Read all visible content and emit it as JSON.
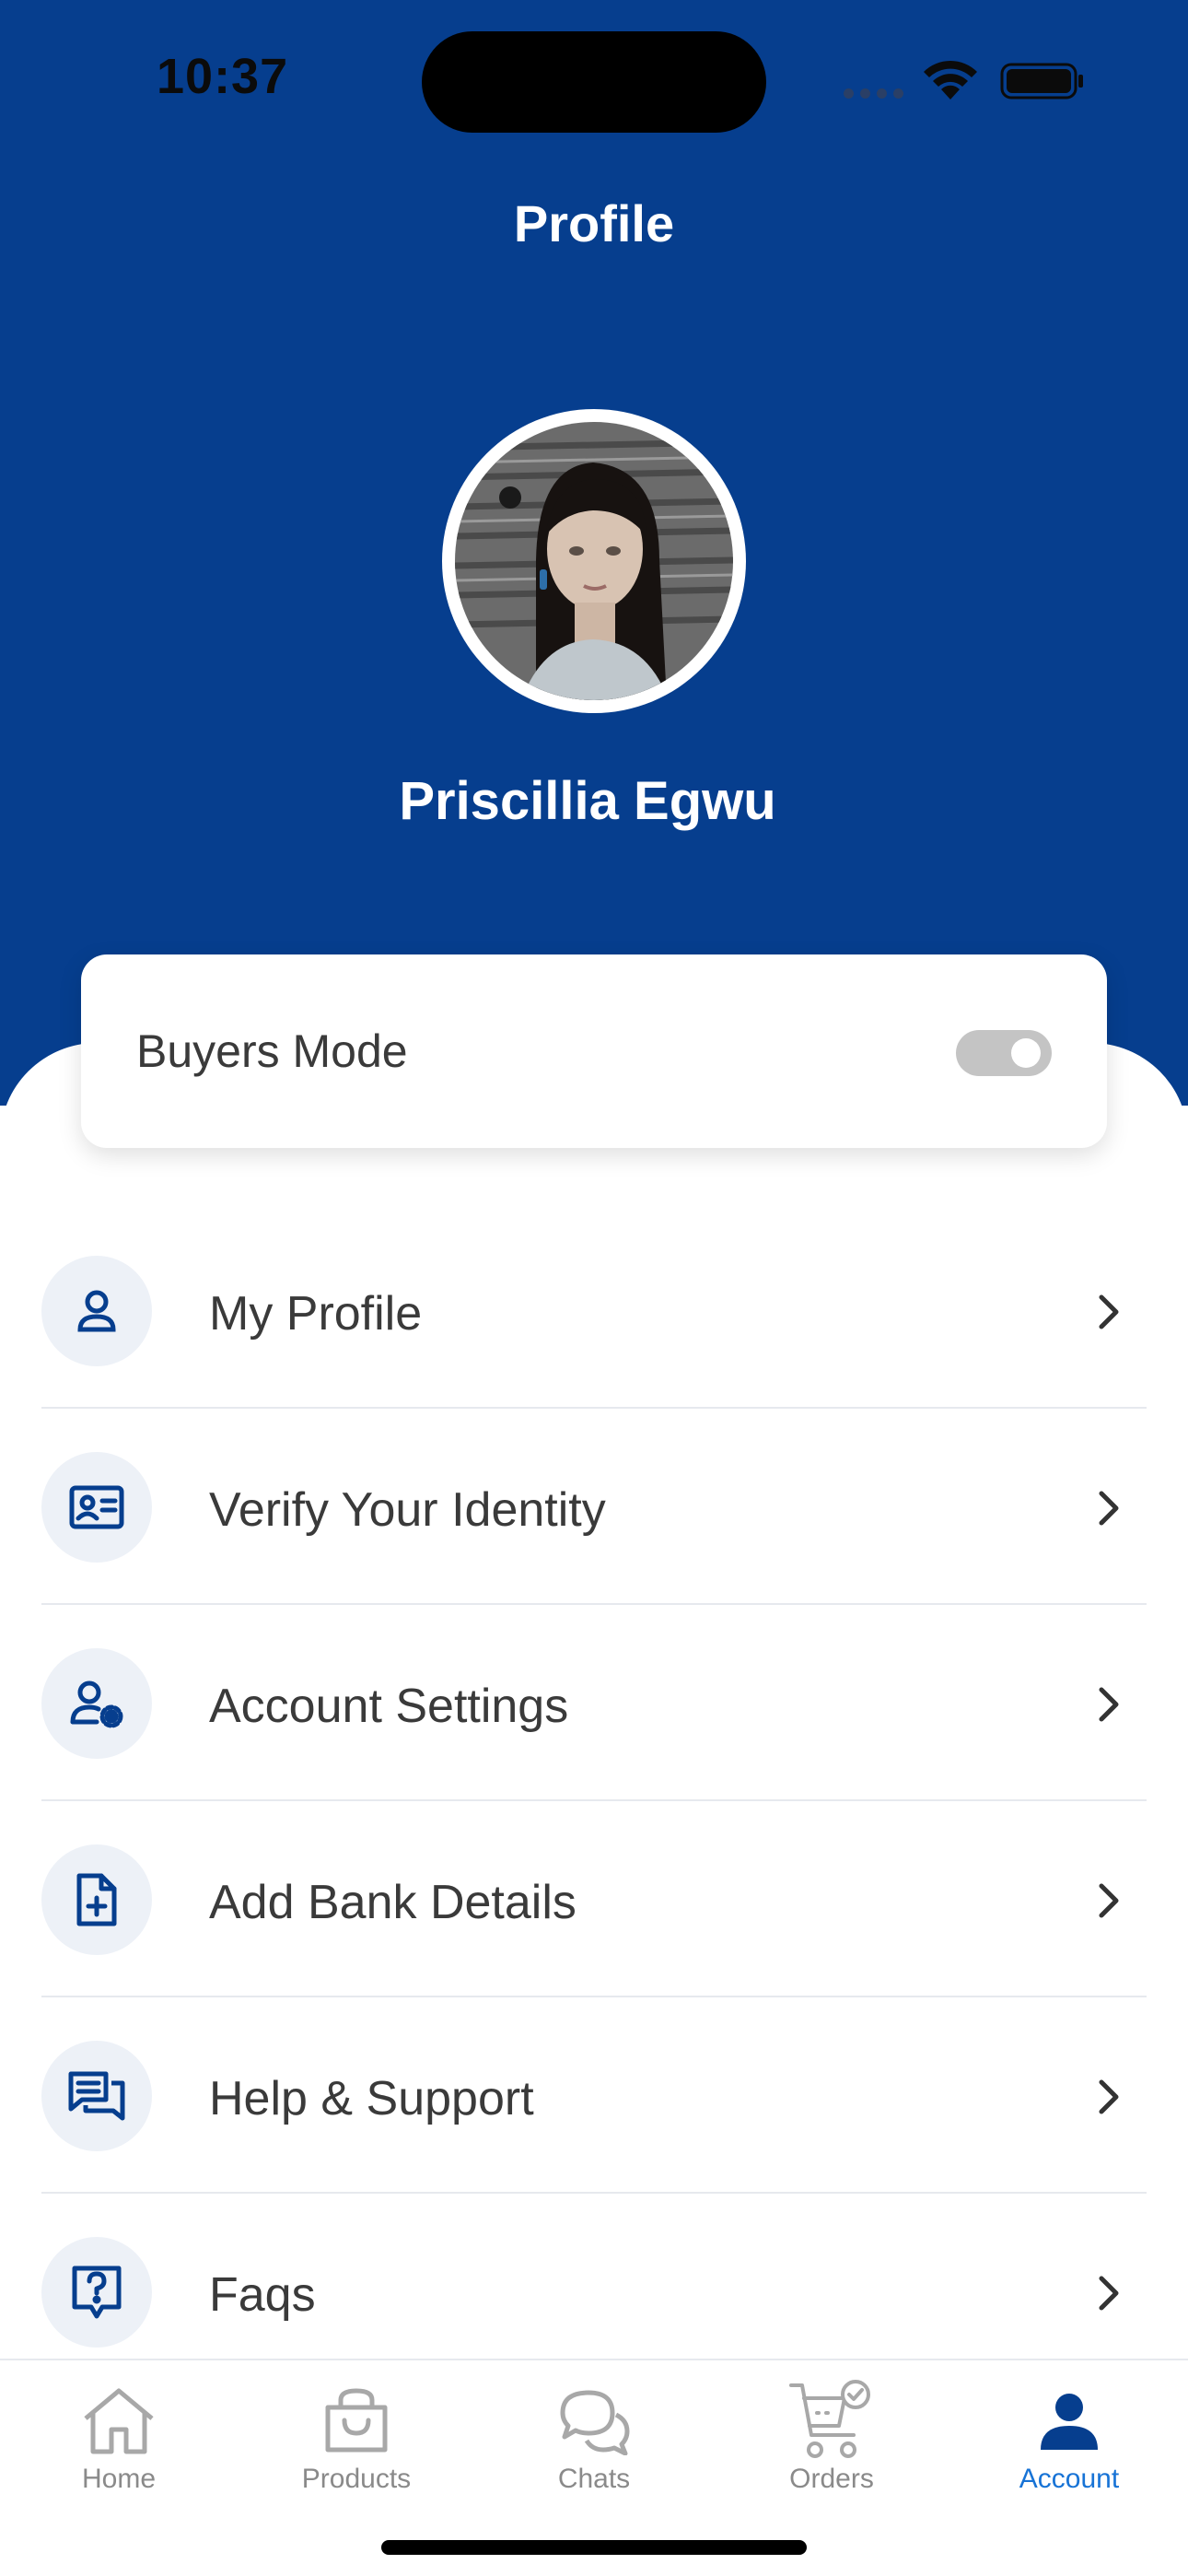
{
  "status_bar": {
    "time": "10:37"
  },
  "header": {
    "title": "Profile"
  },
  "user": {
    "name": "Priscillia Egwu"
  },
  "mode": {
    "label": "Buyers Mode",
    "enabled": false
  },
  "menu": [
    {
      "label": "My Profile",
      "icon": "user-icon"
    },
    {
      "label": "Verify Your Identity",
      "icon": "id-card-icon"
    },
    {
      "label": "Account Settings",
      "icon": "user-settings-icon"
    },
    {
      "label": "Add Bank Details",
      "icon": "file-plus-icon"
    },
    {
      "label": "Help & Support",
      "icon": "chat-bubbles-icon"
    },
    {
      "label": "Faqs",
      "icon": "question-icon"
    }
  ],
  "tabs": [
    {
      "label": "Home",
      "icon": "home-icon",
      "active": false
    },
    {
      "label": "Products",
      "icon": "bag-icon",
      "active": false
    },
    {
      "label": "Chats",
      "icon": "chat-icon",
      "active": false
    },
    {
      "label": "Orders",
      "icon": "cart-icon",
      "active": false
    },
    {
      "label": "Account",
      "icon": "account-icon",
      "active": true
    }
  ],
  "colors": {
    "primary": "#063E8E",
    "accent": "#1773D6",
    "tab_inactive": "#8A8A8A"
  }
}
